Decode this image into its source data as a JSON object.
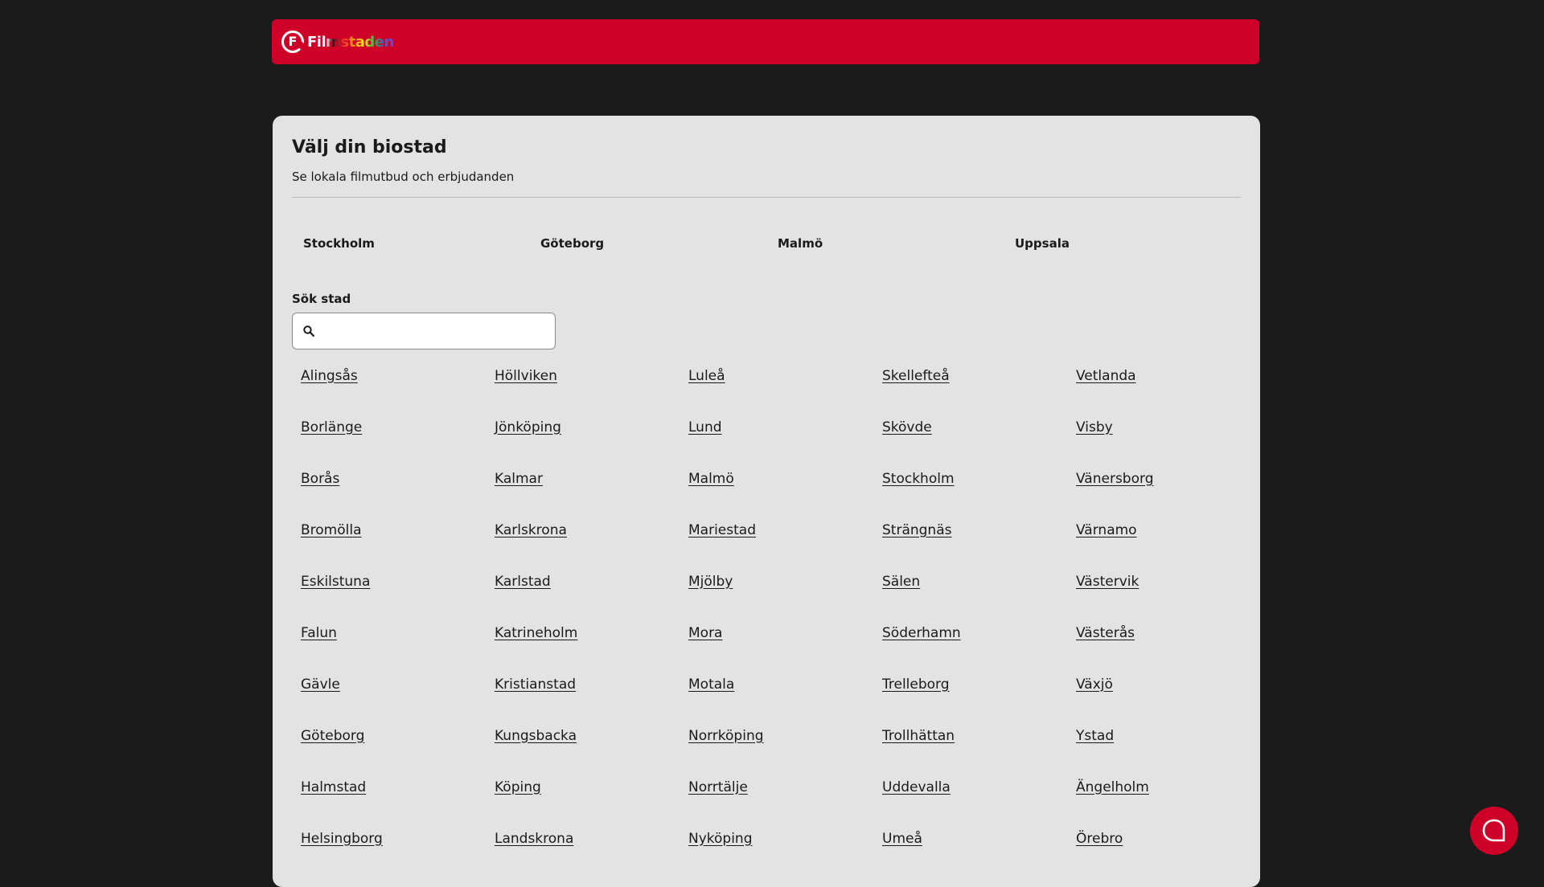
{
  "header": {
    "logo_text": "Filmstaden"
  },
  "picker": {
    "title": "Välj din biostad",
    "subtitle": "Se lokala filmutbud och erbjudanden",
    "quick_cities": [
      "Stockholm",
      "Göteborg",
      "Malmö",
      "Uppsala"
    ],
    "search_label": "Sök stad",
    "search_value": "",
    "cities": [
      "Alingsås",
      "Höllviken",
      "Luleå",
      "Skellefteå",
      "Vetlanda",
      "Borlänge",
      "Jönköping",
      "Lund",
      "Skövde",
      "Visby",
      "Borås",
      "Kalmar",
      "Malmö",
      "Stockholm",
      "Vänersborg",
      "Bromölla",
      "Karlskrona",
      "Mariestad",
      "Strängnäs",
      "Värnamo",
      "Eskilstuna",
      "Karlstad",
      "Mjölby",
      "Sälen",
      "Västervik",
      "Falun",
      "Katrineholm",
      "Mora",
      "Söderhamn",
      "Västerås",
      "Gävle",
      "Kristianstad",
      "Motala",
      "Trelleborg",
      "Växjö",
      "Göteborg",
      "Kungsbacka",
      "Norrköping",
      "Trollhättan",
      "Ystad",
      "Halmstad",
      "Köping",
      "Norrtälje",
      "Uddevalla",
      "Ängelholm",
      "Helsingborg",
      "Landskrona",
      "Nyköping",
      "Umeå",
      "Örebro"
    ]
  },
  "icons": {
    "logo": "filmstaden-logo-icon",
    "search": "search-icon",
    "chat": "chat-bubble-icon"
  },
  "colors": {
    "brand_red": "#cf0027",
    "page_background": "#1b1b1b",
    "panel_background": "#e3e3e3"
  }
}
